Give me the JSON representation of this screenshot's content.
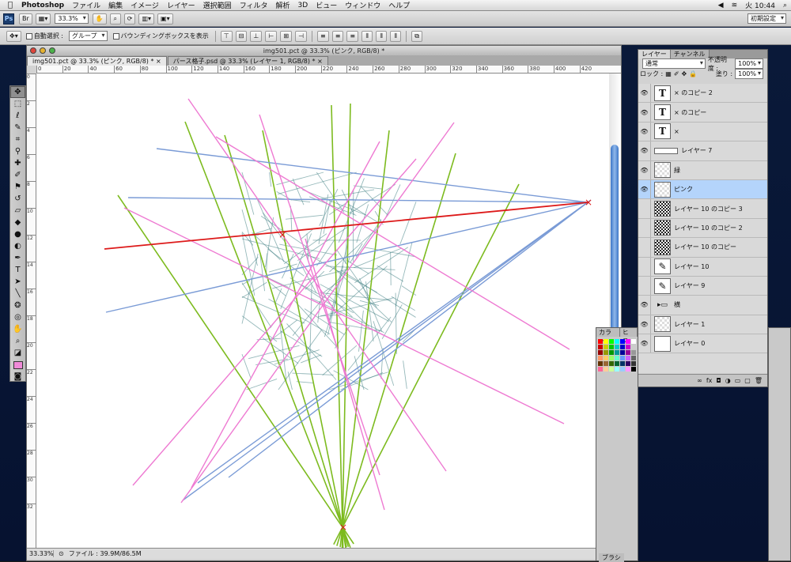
{
  "menubar": {
    "app": "Photoshop",
    "items": [
      "ファイル",
      "編集",
      "イメージ",
      "レイヤー",
      "選択範囲",
      "フィルタ",
      "解析",
      "3D",
      "ビュー",
      "ウィンドウ",
      "ヘルプ"
    ],
    "clock": "火 10:44",
    "workspace": "初期設定"
  },
  "appbar": {
    "ps_badge": "Ps",
    "zoom": "33.3%"
  },
  "options": {
    "auto_select_label": "自動選択 :",
    "auto_select_value": "グループ",
    "bounding_box_label": "バウンディングボックスを表示"
  },
  "document": {
    "title": "img501.pct @ 33.3% (ピンク, RGB/8) *",
    "tabs": [
      "img501.pct @ 33.3% (ピンク, RGB/8) *",
      "パース格子.psd @ 33.3% (レイヤー 1, RGB/8) *"
    ],
    "ruler_labels": [
      "0",
      "20",
      "40",
      "60",
      "80",
      "100",
      "120",
      "140",
      "160",
      "180",
      "200",
      "220",
      "240",
      "260",
      "280",
      "300",
      "320",
      "340",
      "360",
      "380",
      "400",
      "420"
    ],
    "vruler_labels": [
      "0",
      "2",
      "4",
      "6",
      "8",
      "10",
      "12",
      "14",
      "16",
      "18",
      "20",
      "22",
      "24",
      "26",
      "28",
      "30",
      "32"
    ],
    "status_zoom": "33.33%",
    "status_file": "ファイル : 39.9M/86.5M"
  },
  "layers_panel": {
    "tabs": [
      "レイヤー",
      "チャンネル"
    ],
    "blend_mode": "通常",
    "opacity_label": "不透明度 :",
    "opacity": "100%",
    "lock_label": "ロック :",
    "fill_label": "塗り :",
    "fill": "100%",
    "layers": [
      {
        "name": "× のコピー 2",
        "thumb": "T",
        "eye": true
      },
      {
        "name": "× のコピー",
        "thumb": "T",
        "eye": true
      },
      {
        "name": "×",
        "thumb": "T",
        "eye": true
      },
      {
        "name": "レイヤー 7",
        "thumb": "line",
        "eye": true
      },
      {
        "name": "緑",
        "thumb": "checker",
        "eye": true
      },
      {
        "name": "ピンク",
        "thumb": "checker",
        "eye": true,
        "selected": true
      },
      {
        "name": "レイヤー 10 のコピー 3",
        "thumb": "dense",
        "eye": false
      },
      {
        "name": "レイヤー 10 のコピー 2",
        "thumb": "dense",
        "eye": false
      },
      {
        "name": "レイヤー 10 のコピー",
        "thumb": "dense",
        "eye": false
      },
      {
        "name": "レイヤー 10",
        "thumb": "sketch",
        "eye": false
      },
      {
        "name": "レイヤー 9",
        "thumb": "sketch",
        "eye": false
      },
      {
        "name": "横",
        "thumb": "folder",
        "eye": true
      },
      {
        "name": "レイヤー 1",
        "thumb": "checker",
        "eye": true
      },
      {
        "name": "レイヤー 0",
        "thumb": "white",
        "eye": true
      }
    ]
  },
  "color_panel": {
    "tabs": [
      "カラー",
      "ヒス"
    ],
    "brush_label": "ブラシ"
  },
  "colors": {
    "green": "#7dbb1f",
    "pink": "#ee7ad2",
    "blue": "#7a9bd6",
    "red": "#dd1a1a",
    "sketch": "#3f7f82"
  }
}
